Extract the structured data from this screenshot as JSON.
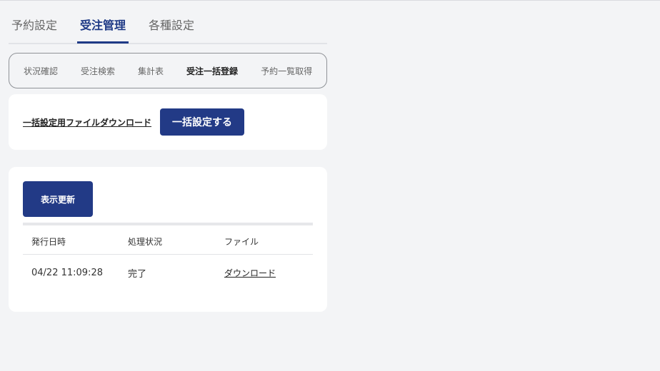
{
  "main_tabs": [
    {
      "label": "予約設定"
    },
    {
      "label": "受注管理"
    },
    {
      "label": "各種設定"
    }
  ],
  "sub_tabs": [
    {
      "label": "状況確認"
    },
    {
      "label": "受注検索"
    },
    {
      "label": "集計表"
    },
    {
      "label": "受注一括登録"
    },
    {
      "label": "予約一覧取得"
    }
  ],
  "bulk": {
    "download_link": "一括設定用ファイルダウンロード",
    "button_label": "一括設定する"
  },
  "history": {
    "refresh_label": "表示更新",
    "columns": [
      "発行日時",
      "処理状況",
      "ファイル"
    ],
    "rows": [
      {
        "issued_at": "04/22 11:09:28",
        "status": "完了",
        "file": "ダウンロード"
      }
    ]
  },
  "colors": {
    "accent": "#223a86",
    "background": "#f3f4f6"
  }
}
